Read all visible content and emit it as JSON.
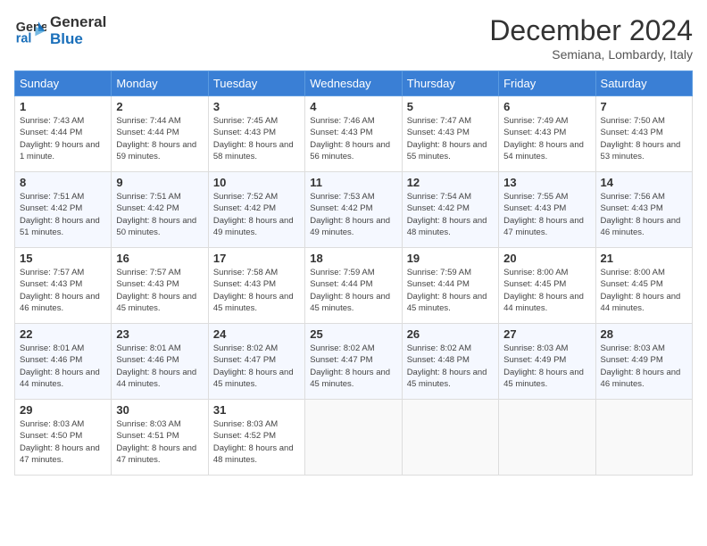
{
  "header": {
    "logo_line1": "General",
    "logo_line2": "Blue",
    "month": "December 2024",
    "location": "Semiana, Lombardy, Italy"
  },
  "weekdays": [
    "Sunday",
    "Monday",
    "Tuesday",
    "Wednesday",
    "Thursday",
    "Friday",
    "Saturday"
  ],
  "weeks": [
    [
      {
        "day": "1",
        "sunrise": "7:43 AM",
        "sunset": "4:44 PM",
        "daylight": "9 hours and 1 minute."
      },
      {
        "day": "2",
        "sunrise": "7:44 AM",
        "sunset": "4:44 PM",
        "daylight": "8 hours and 59 minutes."
      },
      {
        "day": "3",
        "sunrise": "7:45 AM",
        "sunset": "4:43 PM",
        "daylight": "8 hours and 58 minutes."
      },
      {
        "day": "4",
        "sunrise": "7:46 AM",
        "sunset": "4:43 PM",
        "daylight": "8 hours and 56 minutes."
      },
      {
        "day": "5",
        "sunrise": "7:47 AM",
        "sunset": "4:43 PM",
        "daylight": "8 hours and 55 minutes."
      },
      {
        "day": "6",
        "sunrise": "7:49 AM",
        "sunset": "4:43 PM",
        "daylight": "8 hours and 54 minutes."
      },
      {
        "day": "7",
        "sunrise": "7:50 AM",
        "sunset": "4:43 PM",
        "daylight": "8 hours and 53 minutes."
      }
    ],
    [
      {
        "day": "8",
        "sunrise": "7:51 AM",
        "sunset": "4:42 PM",
        "daylight": "8 hours and 51 minutes."
      },
      {
        "day": "9",
        "sunrise": "7:51 AM",
        "sunset": "4:42 PM",
        "daylight": "8 hours and 50 minutes."
      },
      {
        "day": "10",
        "sunrise": "7:52 AM",
        "sunset": "4:42 PM",
        "daylight": "8 hours and 49 minutes."
      },
      {
        "day": "11",
        "sunrise": "7:53 AM",
        "sunset": "4:42 PM",
        "daylight": "8 hours and 49 minutes."
      },
      {
        "day": "12",
        "sunrise": "7:54 AM",
        "sunset": "4:42 PM",
        "daylight": "8 hours and 48 minutes."
      },
      {
        "day": "13",
        "sunrise": "7:55 AM",
        "sunset": "4:43 PM",
        "daylight": "8 hours and 47 minutes."
      },
      {
        "day": "14",
        "sunrise": "7:56 AM",
        "sunset": "4:43 PM",
        "daylight": "8 hours and 46 minutes."
      }
    ],
    [
      {
        "day": "15",
        "sunrise": "7:57 AM",
        "sunset": "4:43 PM",
        "daylight": "8 hours and 46 minutes."
      },
      {
        "day": "16",
        "sunrise": "7:57 AM",
        "sunset": "4:43 PM",
        "daylight": "8 hours and 45 minutes."
      },
      {
        "day": "17",
        "sunrise": "7:58 AM",
        "sunset": "4:43 PM",
        "daylight": "8 hours and 45 minutes."
      },
      {
        "day": "18",
        "sunrise": "7:59 AM",
        "sunset": "4:44 PM",
        "daylight": "8 hours and 45 minutes."
      },
      {
        "day": "19",
        "sunrise": "7:59 AM",
        "sunset": "4:44 PM",
        "daylight": "8 hours and 45 minutes."
      },
      {
        "day": "20",
        "sunrise": "8:00 AM",
        "sunset": "4:45 PM",
        "daylight": "8 hours and 44 minutes."
      },
      {
        "day": "21",
        "sunrise": "8:00 AM",
        "sunset": "4:45 PM",
        "daylight": "8 hours and 44 minutes."
      }
    ],
    [
      {
        "day": "22",
        "sunrise": "8:01 AM",
        "sunset": "4:46 PM",
        "daylight": "8 hours and 44 minutes."
      },
      {
        "day": "23",
        "sunrise": "8:01 AM",
        "sunset": "4:46 PM",
        "daylight": "8 hours and 44 minutes."
      },
      {
        "day": "24",
        "sunrise": "8:02 AM",
        "sunset": "4:47 PM",
        "daylight": "8 hours and 45 minutes."
      },
      {
        "day": "25",
        "sunrise": "8:02 AM",
        "sunset": "4:47 PM",
        "daylight": "8 hours and 45 minutes."
      },
      {
        "day": "26",
        "sunrise": "8:02 AM",
        "sunset": "4:48 PM",
        "daylight": "8 hours and 45 minutes."
      },
      {
        "day": "27",
        "sunrise": "8:03 AM",
        "sunset": "4:49 PM",
        "daylight": "8 hours and 45 minutes."
      },
      {
        "day": "28",
        "sunrise": "8:03 AM",
        "sunset": "4:49 PM",
        "daylight": "8 hours and 46 minutes."
      }
    ],
    [
      {
        "day": "29",
        "sunrise": "8:03 AM",
        "sunset": "4:50 PM",
        "daylight": "8 hours and 47 minutes."
      },
      {
        "day": "30",
        "sunrise": "8:03 AM",
        "sunset": "4:51 PM",
        "daylight": "8 hours and 47 minutes."
      },
      {
        "day": "31",
        "sunrise": "8:03 AM",
        "sunset": "4:52 PM",
        "daylight": "8 hours and 48 minutes."
      },
      null,
      null,
      null,
      null
    ]
  ]
}
